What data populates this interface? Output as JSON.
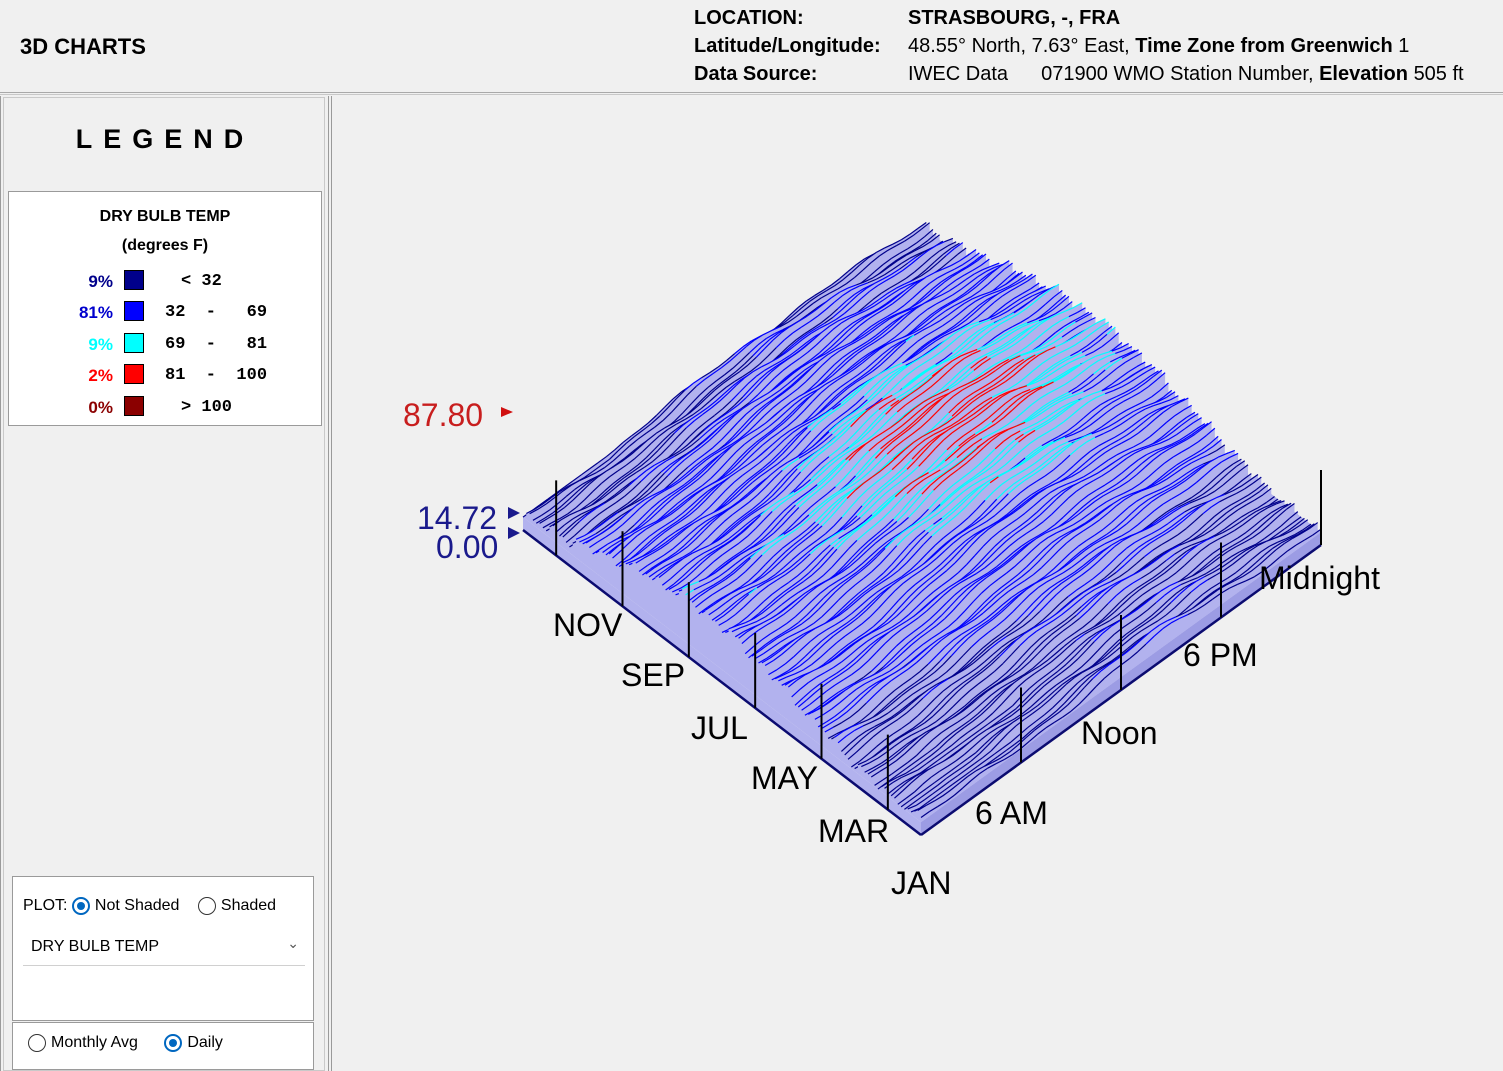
{
  "header": {
    "app_title": "3D CHARTS",
    "location_label": "LOCATION:",
    "location_value": "STRASBOURG, -, FRA",
    "latlon_label": "Latitude/Longitude:",
    "latlon_value": "48.55° North, 7.63° East,",
    "timezone_label": "Time Zone from Greenwich",
    "timezone_value": "1",
    "datasource_label": "Data Source:",
    "datasource_value": "IWEC Data",
    "station_value": "071900 WMO Station Number,",
    "elevation_label": "Elevation",
    "elevation_value": "505 ft"
  },
  "legend": {
    "heading": "LEGEND",
    "title_line1": "DRY BULB TEMP",
    "title_line2": "(degrees F)",
    "items": [
      {
        "pct": "9%",
        "range": "< 32",
        "color": "#00008b",
        "pct_color": "#00008b"
      },
      {
        "pct": "81%",
        "range": "32  -   69",
        "color": "#0000ff",
        "pct_color": "#0000cd"
      },
      {
        "pct": "9%",
        "range": "69  -   81",
        "color": "#00ffff",
        "pct_color": "#00ffff"
      },
      {
        "pct": "2%",
        "range": "81  -  100",
        "color": "#ff0000",
        "pct_color": "#ff0000"
      },
      {
        "pct": "0%",
        "range": "> 100",
        "color": "#8b0000",
        "pct_color": "#8b0000"
      }
    ]
  },
  "controls": {
    "plot_label": "PLOT:",
    "not_shaded_label": "Not Shaded",
    "shaded_label": "Shaded",
    "plot_mode": "Not Shaded",
    "variable_value": "DRY BULB TEMP",
    "monthly_avg_label": "Monthly Avg",
    "daily_label": "Daily",
    "aggregation_mode": "Daily"
  },
  "chart_data": {
    "type": "surface3d",
    "variable": "DRY BULB TEMP",
    "z_max_marker": "87.80",
    "z_min_marker": "14.72",
    "z_base": "0.00",
    "month_ticks": [
      "JAN",
      "MAR",
      "MAY",
      "JUL",
      "SEP",
      "NOV"
    ],
    "hour_ticks": [
      "6 AM",
      "Noon",
      "6 PM",
      "Midnight"
    ],
    "peak_region": {
      "months": [
        "JUN",
        "JUL",
        "AUG"
      ],
      "hours": [
        "Noon",
        "6 PM"
      ],
      "max": 87.8
    },
    "colors": {
      "below_32": "#00008b",
      "32_69": "#0000ff",
      "69_81": "#00ffff",
      "81_100": "#ff0000",
      "above_100": "#8b0000",
      "base_fill": "#b2b2ee"
    }
  }
}
